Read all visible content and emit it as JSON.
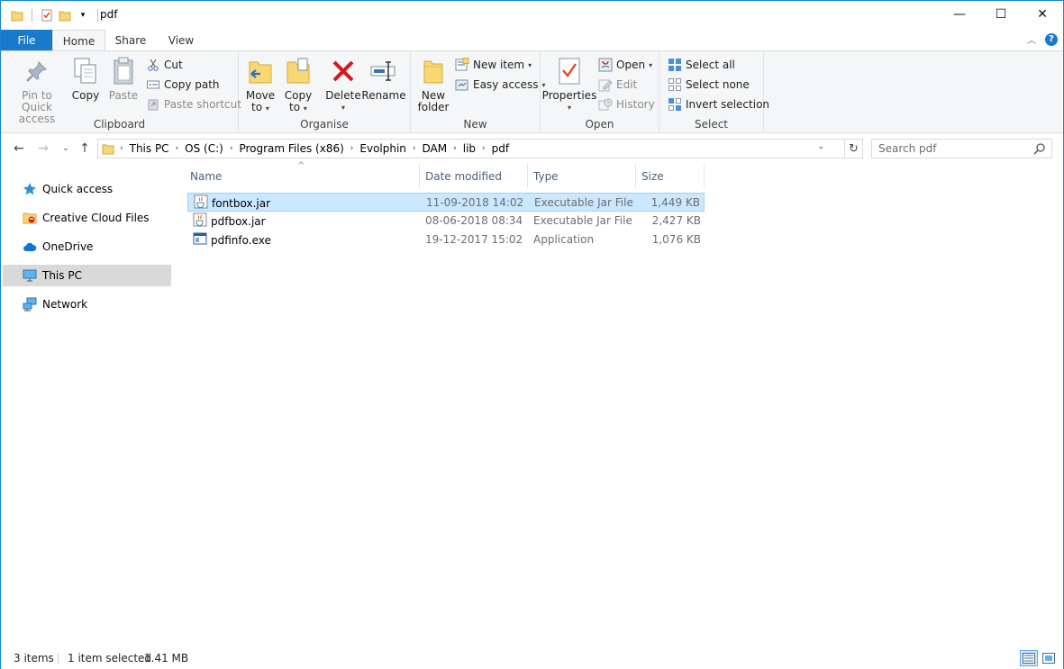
{
  "window": {
    "title": "pdf",
    "minimize_glyph": "—",
    "maximize_glyph": "☐",
    "close_glyph": "✕"
  },
  "tabs": {
    "file": "File",
    "home": "Home",
    "share": "Share",
    "view": "View"
  },
  "ribbon": {
    "clipboard": {
      "label": "Clipboard",
      "pin_line1": "Pin to Quick",
      "pin_line2": "access",
      "copy": "Copy",
      "paste": "Paste",
      "cut": "Cut",
      "copy_path": "Copy path",
      "paste_shortcut": "Paste shortcut"
    },
    "organise": {
      "label": "Organise",
      "move_line1": "Move",
      "move_line2": "to",
      "copy_line1": "Copy",
      "copy_line2": "to",
      "delete": "Delete",
      "rename": "Rename"
    },
    "new": {
      "label": "New",
      "folder_line1": "New",
      "folder_line2": "folder",
      "new_item": "New item",
      "easy_access": "Easy access"
    },
    "open": {
      "label": "Open",
      "properties": "Properties",
      "open": "Open",
      "edit": "Edit",
      "history": "History"
    },
    "select": {
      "label": "Select",
      "select_all": "Select all",
      "select_none": "Select none",
      "invert_selection": "Invert selection"
    }
  },
  "address": {
    "crumbs": [
      "This PC",
      "OS (C:)",
      "Program Files (x86)",
      "Evolphin",
      "DAM",
      "lib",
      "pdf"
    ],
    "search_placeholder": "Search pdf"
  },
  "nav_pane": {
    "items": [
      {
        "label": "Quick access",
        "icon": "star-icon"
      },
      {
        "label": "Creative Cloud Files",
        "icon": "cc-folder-icon"
      },
      {
        "label": "OneDrive",
        "icon": "cloud-icon"
      },
      {
        "label": "This PC",
        "icon": "computer-icon"
      },
      {
        "label": "Network",
        "icon": "network-icon"
      }
    ]
  },
  "columns": {
    "name": "Name",
    "date": "Date modified",
    "type": "Type",
    "size": "Size"
  },
  "files": [
    {
      "name": "fontbox.jar",
      "date": "11-09-2018 14:02",
      "type": "Executable Jar File",
      "size": "1,449 KB",
      "icon": "jar-icon"
    },
    {
      "name": "pdfbox.jar",
      "date": "08-06-2018 08:34",
      "type": "Executable Jar File",
      "size": "2,427 KB",
      "icon": "jar-icon"
    },
    {
      "name": "pdfinfo.exe",
      "date": "19-12-2017 15:02",
      "type": "Application",
      "size": "1,076 KB",
      "icon": "exe-icon"
    }
  ],
  "status": {
    "items": "3 items",
    "selected": "1 item selected",
    "selected_size": "1.41 MB"
  },
  "colors": {
    "accent": "#1979ca",
    "selection": "#cce8ff",
    "nav_selected": "#d9d9d9"
  }
}
